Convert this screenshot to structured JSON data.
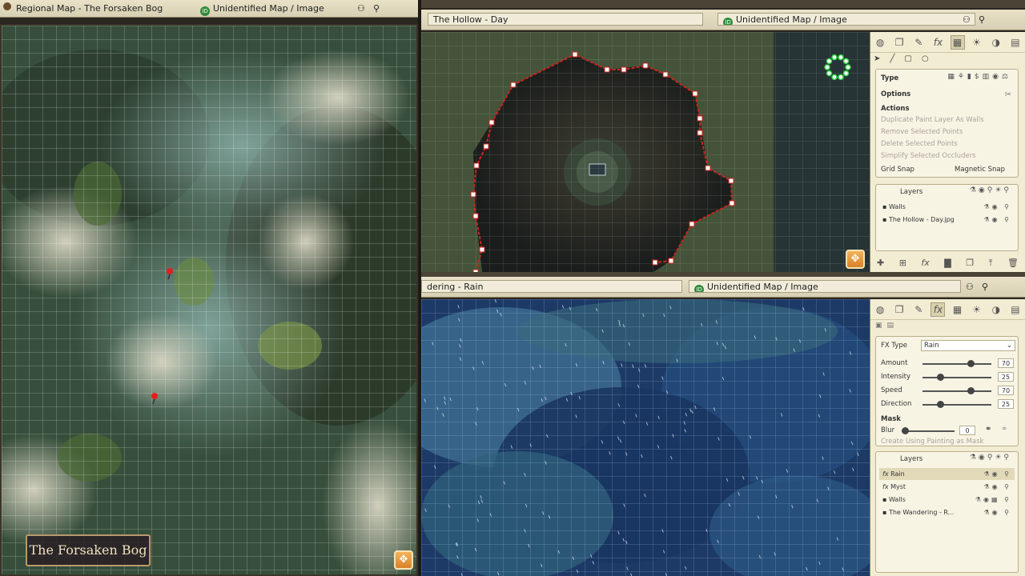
{
  "left_window": {
    "title": "Regional Map - The Forsaken Bog",
    "type_label": "Unidentified Map / Image",
    "map_caption": "The Forsaken Bog"
  },
  "top_window": {
    "title": "The Hollow - Day",
    "type_label": "Unidentified Map / Image",
    "tools": [
      "select",
      "line",
      "rect",
      "circle"
    ],
    "wall_panel": {
      "type_label": "Type",
      "options_label": "Options",
      "actions_label": "Actions",
      "actions": [
        "Duplicate Paint Layer As Walls",
        "Remove Selected Points",
        "Delete Selected Points",
        "Simplify Selected Occluders"
      ],
      "grid_snap": "Grid Snap",
      "magnetic_snap": "Magnetic Snap"
    },
    "layers_label": "Layers",
    "layers": [
      "Walls",
      "The Hollow - Day.jpg"
    ]
  },
  "bottom_window": {
    "title": "dering - Rain",
    "type_label": "Unidentified Map / Image",
    "fx_panel": {
      "fx_type_label": "FX Type",
      "fx_type_value": "Rain",
      "sliders": [
        {
          "label": "Amount",
          "value": "70",
          "fraction": 0.7
        },
        {
          "label": "Intensity",
          "value": "25",
          "fraction": 0.25
        },
        {
          "label": "Speed",
          "value": "70",
          "fraction": 0.7
        },
        {
          "label": "Direction",
          "value": "25",
          "fraction": 0.25
        }
      ],
      "mask_label": "Mask",
      "blur_label": "Blur",
      "blur_value": "0",
      "create_mask": "Create Using Painting as Mask"
    },
    "layers_label": "Layers",
    "layers": [
      "Rain",
      "Myst",
      "Walls",
      "The Wandering - R..."
    ]
  },
  "colors": {
    "wall_red": "#c8261e",
    "panel_bg": "#f2ecd2",
    "selection_green": "#36d34a"
  }
}
